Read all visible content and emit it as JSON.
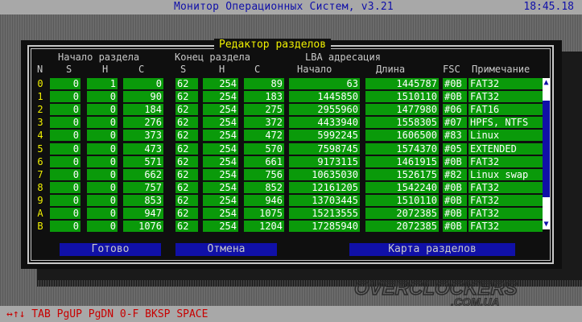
{
  "app": {
    "title": "Монитор Операционных Систем, v3.21",
    "clock": "18:45.18"
  },
  "dialog": {
    "title": "Редактор разделов"
  },
  "headers": {
    "start_group": "Начало раздела",
    "end_group": "Конец раздела",
    "lba_group": "LBA  адресация",
    "n": "N",
    "s1": "S",
    "h1": "H",
    "c1": "C",
    "s2": "S",
    "h2": "H",
    "c2": "C",
    "lba_start": "Начало",
    "lba_len": "Длина",
    "fsc": "FSC",
    "note": "Примечание"
  },
  "rows": [
    {
      "n": "0",
      "s1": "0",
      "h1": "1",
      "c1": "0",
      "s2": "62",
      "h2": "254",
      "c2": "89",
      "start": "63",
      "len": "1445787",
      "fsc": "#0B",
      "note": "FAT32"
    },
    {
      "n": "1",
      "s1": "0",
      "h1": "0",
      "c1": "90",
      "s2": "62",
      "h2": "254",
      "c2": "183",
      "start": "1445850",
      "len": "1510110",
      "fsc": "#0B",
      "note": "FAT32"
    },
    {
      "n": "2",
      "s1": "0",
      "h1": "0",
      "c1": "184",
      "s2": "62",
      "h2": "254",
      "c2": "275",
      "start": "2955960",
      "len": "1477980",
      "fsc": "#06",
      "note": "FAT16"
    },
    {
      "n": "3",
      "s1": "0",
      "h1": "0",
      "c1": "276",
      "s2": "62",
      "h2": "254",
      "c2": "372",
      "start": "4433940",
      "len": "1558305",
      "fsc": "#07",
      "note": "HPFS, NTFS"
    },
    {
      "n": "4",
      "s1": "0",
      "h1": "0",
      "c1": "373",
      "s2": "62",
      "h2": "254",
      "c2": "472",
      "start": "5992245",
      "len": "1606500",
      "fsc": "#83",
      "note": "Linux"
    },
    {
      "n": "5",
      "s1": "0",
      "h1": "0",
      "c1": "473",
      "s2": "62",
      "h2": "254",
      "c2": "570",
      "start": "7598745",
      "len": "1574370",
      "fsc": "#05",
      "note": "EXTENDED"
    },
    {
      "n": "6",
      "s1": "0",
      "h1": "0",
      "c1": "571",
      "s2": "62",
      "h2": "254",
      "c2": "661",
      "start": "9173115",
      "len": "1461915",
      "fsc": "#0B",
      "note": "FAT32"
    },
    {
      "n": "7",
      "s1": "0",
      "h1": "0",
      "c1": "662",
      "s2": "62",
      "h2": "254",
      "c2": "756",
      "start": "10635030",
      "len": "1526175",
      "fsc": "#82",
      "note": "Linux swap"
    },
    {
      "n": "8",
      "s1": "0",
      "h1": "0",
      "c1": "757",
      "s2": "62",
      "h2": "254",
      "c2": "852",
      "start": "12161205",
      "len": "1542240",
      "fsc": "#0B",
      "note": "FAT32"
    },
    {
      "n": "9",
      "s1": "0",
      "h1": "0",
      "c1": "853",
      "s2": "62",
      "h2": "254",
      "c2": "946",
      "start": "13703445",
      "len": "1510110",
      "fsc": "#0B",
      "note": "FAT32"
    },
    {
      "n": "A",
      "s1": "0",
      "h1": "0",
      "c1": "947",
      "s2": "62",
      "h2": "254",
      "c2": "1075",
      "start": "15213555",
      "len": "2072385",
      "fsc": "#0B",
      "note": "FAT32"
    },
    {
      "n": "B",
      "s1": "0",
      "h1": "0",
      "c1": "1076",
      "s2": "62",
      "h2": "254",
      "c2": "1204",
      "start": "17285940",
      "len": "2072385",
      "fsc": "#0B",
      "note": "FAT32"
    }
  ],
  "buttons": {
    "ok": "Готово",
    "cancel": "Отмена",
    "map": "Карта разделов"
  },
  "hotkeys": "↔↑↓ TAB PgUP PgDN 0-F BKSP SPACE",
  "watermark": "OVERCLOCKERS.COM.UA",
  "colors": {
    "cell": "#0a9a0a",
    "accent": "#f0f000",
    "button": "#1010a8",
    "hotkey": "#c80000"
  }
}
